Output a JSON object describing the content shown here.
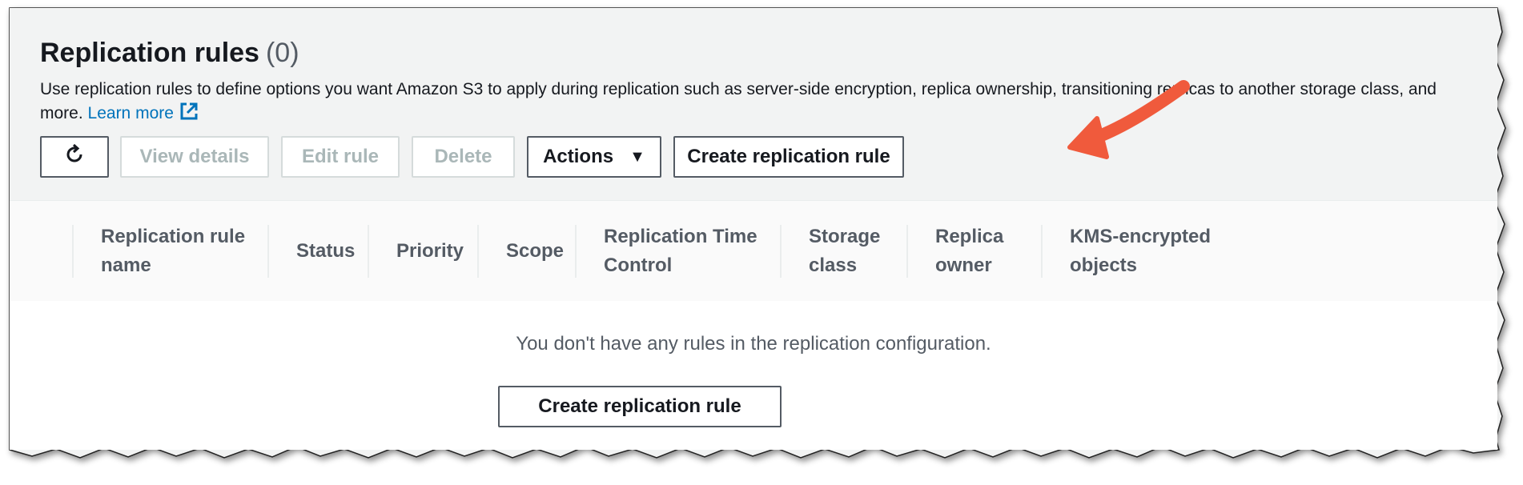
{
  "header": {
    "title": "Replication rules",
    "count": "(0)",
    "description": "Use replication rules to define options you want Amazon S3 to apply during replication such as server-side encryption, replica ownership, transitioning replicas to another storage class, and more.",
    "learn_more": "Learn more"
  },
  "toolbar": {
    "view_details": "View details",
    "edit_rule": "Edit rule",
    "delete": "Delete",
    "actions": "Actions",
    "create": "Create replication rule"
  },
  "table": {
    "columns": [
      {
        "line1": "Replication rule",
        "line2": "name"
      },
      {
        "line1": "Status",
        "line2": ""
      },
      {
        "line1": "Priority",
        "line2": ""
      },
      {
        "line1": "Scope",
        "line2": ""
      },
      {
        "line1": "Replication Time",
        "line2": "Control"
      },
      {
        "line1": "Storage",
        "line2": "class"
      },
      {
        "line1": "Replica",
        "line2": "owner"
      },
      {
        "line1": "KMS-encrypted",
        "line2": "objects"
      }
    ],
    "empty_message": "You don't have any rules in the replication configuration.",
    "empty_create": "Create replication rule"
  },
  "icons": {
    "refresh": "refresh-icon",
    "external_link": "external-link-icon",
    "caret": "caret-down-icon",
    "annotation": "red-arrow-annotation"
  },
  "colors": {
    "link": "#0073bb",
    "arrow": "#f05a3c",
    "panel_bg": "#f2f3f3"
  }
}
